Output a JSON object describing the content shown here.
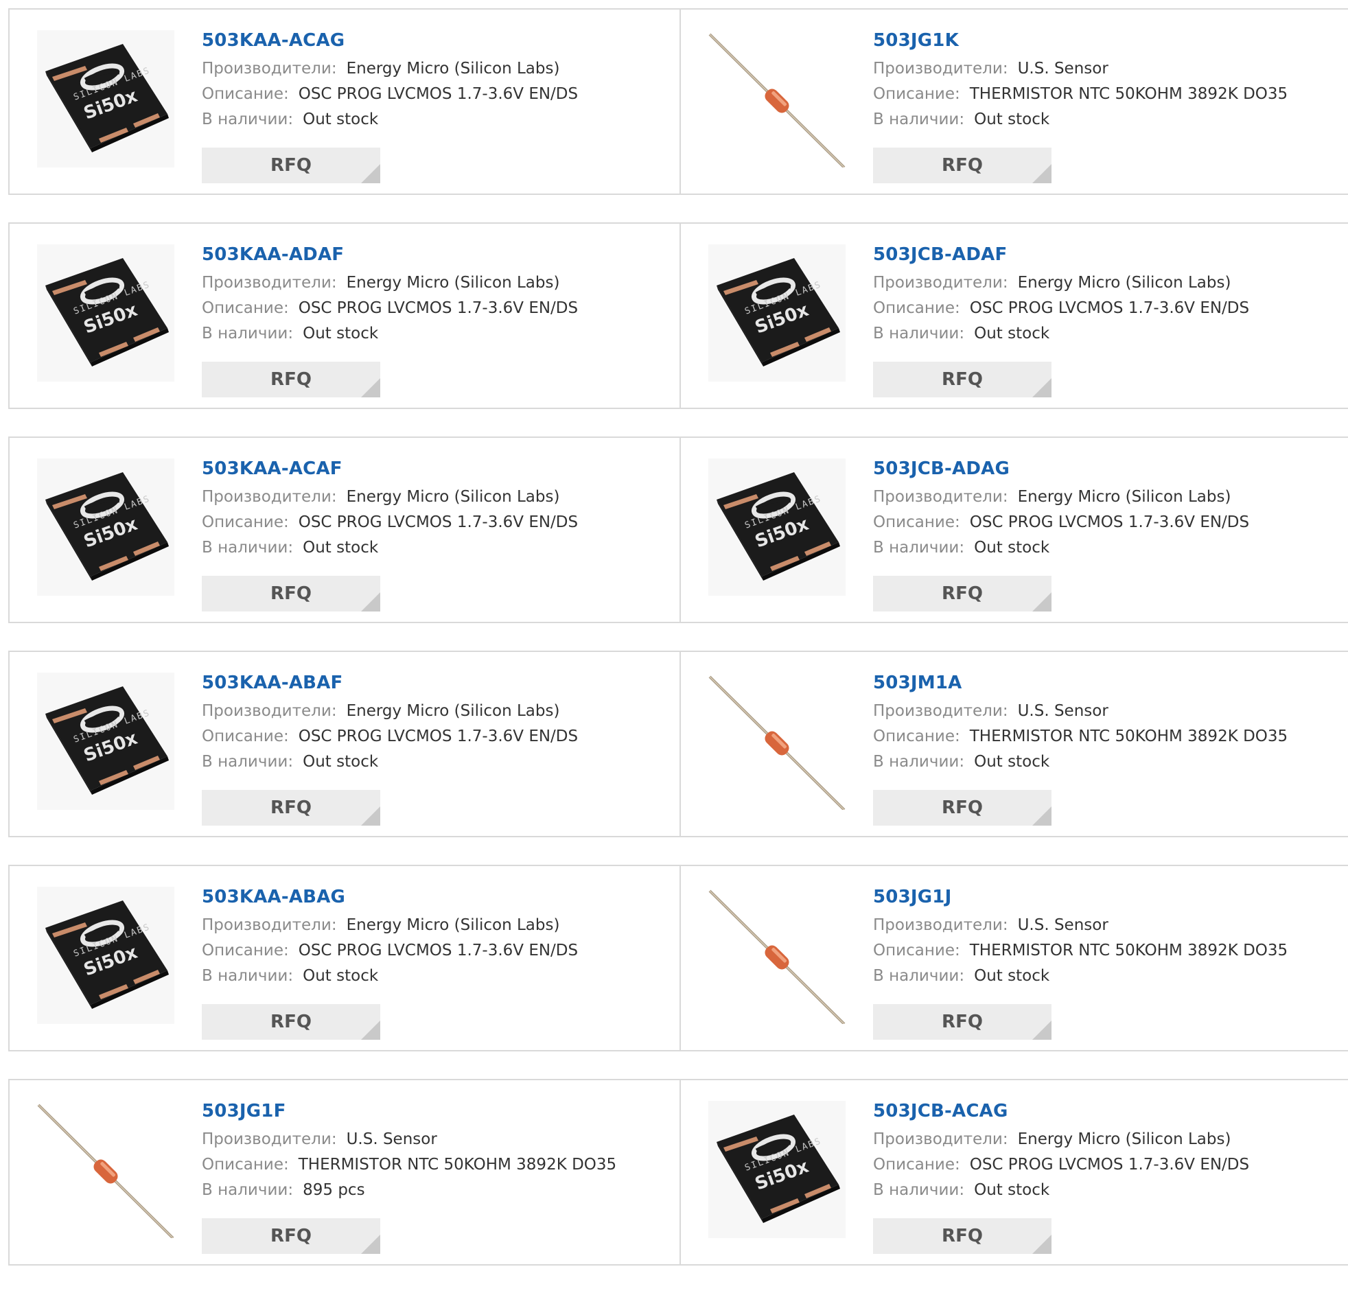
{
  "labels": {
    "manufacturer": "Производители:",
    "description": "Описание:",
    "stock": "В наличии:",
    "rfq": "RFQ"
  },
  "products": [
    {
      "part": "503KAA-ACAG",
      "manufacturer": "Energy Micro (Silicon Labs)",
      "description": "OSC PROG LVCMOS 1.7-3.6V EN/DS",
      "stock": "Out stock",
      "image": "chip"
    },
    {
      "part": "503JG1K",
      "manufacturer": "U.S. Sensor",
      "description": "THERMISTOR NTC 50KOHM 3892K DO35",
      "stock": "Out stock",
      "image": "thermistor"
    },
    {
      "part": "503KAA-ADAF",
      "manufacturer": "Energy Micro (Silicon Labs)",
      "description": "OSC PROG LVCMOS 1.7-3.6V EN/DS",
      "stock": "Out stock",
      "image": "chip"
    },
    {
      "part": "503JCB-ADAF",
      "manufacturer": "Energy Micro (Silicon Labs)",
      "description": "OSC PROG LVCMOS 1.7-3.6V EN/DS",
      "stock": "Out stock",
      "image": "chip"
    },
    {
      "part": "503KAA-ACAF",
      "manufacturer": "Energy Micro (Silicon Labs)",
      "description": "OSC PROG LVCMOS 1.7-3.6V EN/DS",
      "stock": "Out stock",
      "image": "chip"
    },
    {
      "part": "503JCB-ADAG",
      "manufacturer": "Energy Micro (Silicon Labs)",
      "description": "OSC PROG LVCMOS 1.7-3.6V EN/DS",
      "stock": "Out stock",
      "image": "chip"
    },
    {
      "part": "503KAA-ABAF",
      "manufacturer": "Energy Micro (Silicon Labs)",
      "description": "OSC PROG LVCMOS 1.7-3.6V EN/DS",
      "stock": "Out stock",
      "image": "chip"
    },
    {
      "part": "503JM1A",
      "manufacturer": "U.S. Sensor",
      "description": "THERMISTOR NTC 50KOHM 3892K DO35",
      "stock": "Out stock",
      "image": "thermistor"
    },
    {
      "part": "503KAA-ABAG",
      "manufacturer": "Energy Micro (Silicon Labs)",
      "description": "OSC PROG LVCMOS 1.7-3.6V EN/DS",
      "stock": "Out stock",
      "image": "chip"
    },
    {
      "part": "503JG1J",
      "manufacturer": "U.S. Sensor",
      "description": "THERMISTOR NTC 50KOHM 3892K DO35",
      "stock": "Out stock",
      "image": "thermistor"
    },
    {
      "part": "503JG1F",
      "manufacturer": "U.S. Sensor",
      "description": "THERMISTOR NTC 50KOHM 3892K DO35",
      "stock": "895 pcs",
      "image": "thermistor"
    },
    {
      "part": "503JCB-ACAG",
      "manufacturer": "Energy Micro (Silicon Labs)",
      "description": "OSC PROG LVCMOS 1.7-3.6V EN/DS",
      "stock": "Out stock",
      "image": "chip"
    }
  ],
  "chip_marking": {
    "brand": "SILICON LABS",
    "model": "Si50x"
  },
  "colors": {
    "link": "#1a62ad",
    "label": "#8a8a8a",
    "value": "#333333",
    "border": "#d9d9d9",
    "button_bg": "#ececec",
    "button_text": "#555555"
  }
}
